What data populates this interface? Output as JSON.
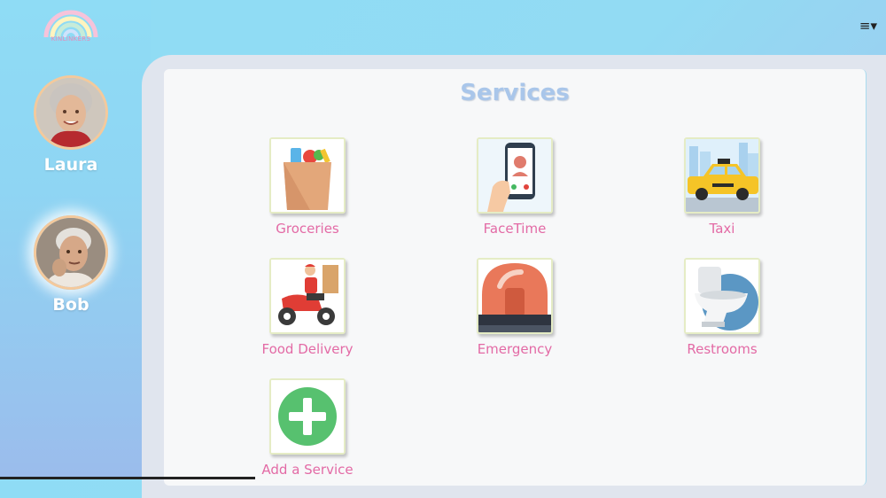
{
  "app": {
    "logo_text": "KINLINKERS",
    "menu_icon": "hamburger-dropdown-icon"
  },
  "sidebar": {
    "users": [
      {
        "name": "Laura",
        "active": false
      },
      {
        "name": "Bob",
        "active": true
      }
    ]
  },
  "main": {
    "title": "Services",
    "services": [
      {
        "label": "Groceries",
        "icon": "grocery-bag-icon"
      },
      {
        "label": "FaceTime",
        "icon": "phone-call-icon"
      },
      {
        "label": "Taxi",
        "icon": "taxi-icon"
      },
      {
        "label": "Food Delivery",
        "icon": "delivery-scooter-icon"
      },
      {
        "label": "Emergency",
        "icon": "siren-icon"
      },
      {
        "label": "Restrooms",
        "icon": "toilet-icon"
      },
      {
        "label": "Add a Service",
        "icon": "add-plus-icon"
      }
    ]
  },
  "colors": {
    "title": "#a9c6ea",
    "label": "#e36aa5",
    "avatar_border": "#f4c99c"
  }
}
